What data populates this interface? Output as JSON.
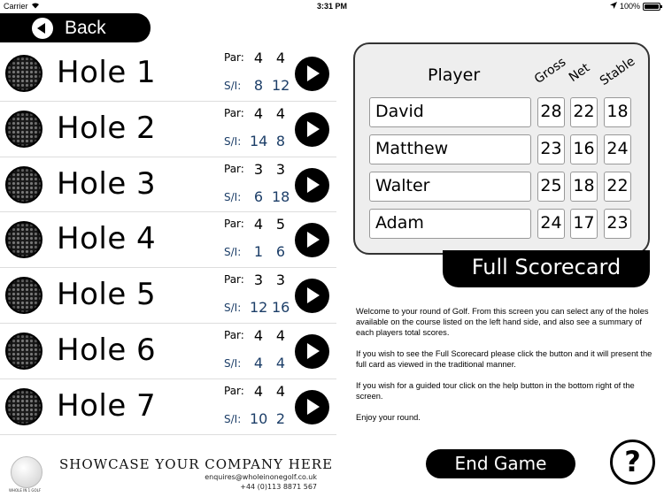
{
  "status_bar": {
    "carrier": "Carrier",
    "time": "3:31 PM",
    "battery": "100%",
    "battery_level": 1.0
  },
  "back_button": {
    "label": "Back"
  },
  "holes": [
    {
      "name": "Hole 1",
      "par_label": "Par:",
      "si_label": "S/I:",
      "par": [
        "4",
        "4"
      ],
      "si": [
        "8",
        "12"
      ]
    },
    {
      "name": "Hole 2",
      "par_label": "Par:",
      "si_label": "S/I:",
      "par": [
        "4",
        "4"
      ],
      "si": [
        "14",
        "8"
      ]
    },
    {
      "name": "Hole 3",
      "par_label": "Par:",
      "si_label": "S/I:",
      "par": [
        "3",
        "3"
      ],
      "si": [
        "6",
        "18"
      ]
    },
    {
      "name": "Hole 4",
      "par_label": "Par:",
      "si_label": "S/I:",
      "par": [
        "4",
        "5"
      ],
      "si": [
        "1",
        "6"
      ]
    },
    {
      "name": "Hole 5",
      "par_label": "Par:",
      "si_label": "S/I:",
      "par": [
        "3",
        "3"
      ],
      "si": [
        "12",
        "16"
      ]
    },
    {
      "name": "Hole 6",
      "par_label": "Par:",
      "si_label": "S/I:",
      "par": [
        "4",
        "4"
      ],
      "si": [
        "4",
        "4"
      ]
    },
    {
      "name": "Hole 7",
      "par_label": "Par:",
      "si_label": "S/I:",
      "par": [
        "4",
        "4"
      ],
      "si": [
        "10",
        "2"
      ]
    }
  ],
  "advert": {
    "title": "SHOWCASE YOUR COMPANY HERE",
    "email": "enquires@wholeinonegolf.co.uk",
    "phone": "+44 (0)113 8871 567",
    "logo_caption": "WHOLE IN 1 GOLF"
  },
  "scorecard": {
    "headers": {
      "player": "Player",
      "gross": "Gross",
      "net": "Net",
      "stable": "Stable"
    },
    "players": [
      {
        "name": "David",
        "gross": "28",
        "net": "22",
        "stable": "18"
      },
      {
        "name": "Matthew",
        "gross": "23",
        "net": "16",
        "stable": "24"
      },
      {
        "name": "Walter",
        "gross": "25",
        "net": "18",
        "stable": "22"
      },
      {
        "name": "Adam",
        "gross": "24",
        "net": "17",
        "stable": "23"
      }
    ]
  },
  "full_scorecard_button": {
    "label": "Full Scorecard"
  },
  "info_text": [
    "Welcome to your round of Golf. From this screen you can select any of the holes available on the course listed on the left hand side, and also see a summary of each players total scores.",
    "If you wish to see the Full Scorecard please click the button and it will present the full card as viewed in the traditional manner.",
    "If you wish for a guided tour click on the help button in the bottom right of the screen.",
    "Enjoy your round."
  ],
  "end_game_button": {
    "label": "End Game"
  },
  "help_button": {
    "label": "?"
  }
}
